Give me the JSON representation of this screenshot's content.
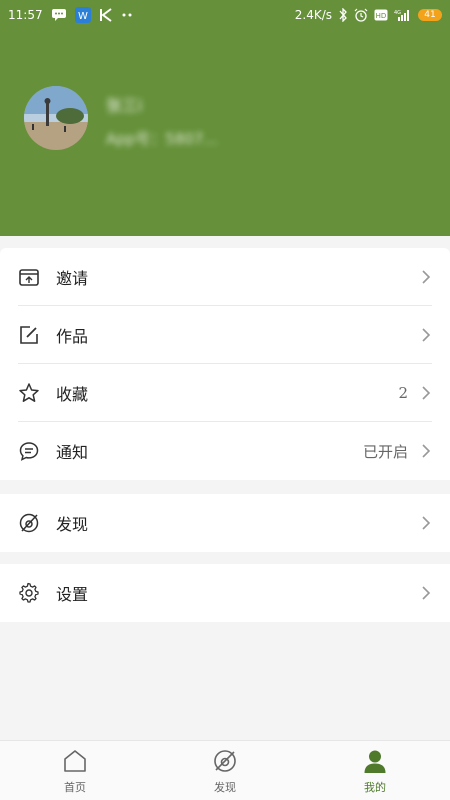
{
  "status_bar": {
    "time": "11:57",
    "net_speed": "2.4K/s",
    "battery": "41",
    "icons_left": [
      "message-icon",
      "browser-icon",
      "k-app-icon",
      "more-dots-icon"
    ],
    "icons_right": [
      "bluetooth-icon",
      "alarm-icon",
      "hd-icon",
      "signal-icon",
      "battery-icon"
    ]
  },
  "profile": {
    "name": "张三i",
    "subtitle": "App号：5807..."
  },
  "menu": {
    "invite": {
      "label": "邀请",
      "icon": "invite-box-icon"
    },
    "works": {
      "label": "作品",
      "icon": "edit-square-icon"
    },
    "favorites": {
      "label": "收藏",
      "value": "2",
      "icon": "star-icon"
    },
    "notifications": {
      "label": "通知",
      "value": "已开启",
      "icon": "chat-bubble-icon"
    },
    "discover": {
      "label": "发现",
      "icon": "compass-slash-icon"
    },
    "settings": {
      "label": "设置",
      "icon": "gear-icon"
    }
  },
  "tabs": [
    {
      "label": "首页",
      "icon": "home-icon"
    },
    {
      "label": "发现",
      "icon": "discover-icon"
    },
    {
      "label": "我的",
      "icon": "user-icon",
      "active": true
    }
  ],
  "colors": {
    "header_bg": "#66913a",
    "active_tab": "#4f7a2c",
    "battery": "#f3a21c"
  }
}
